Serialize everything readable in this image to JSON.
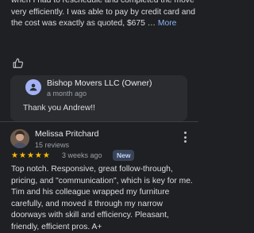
{
  "reviews": [
    {
      "text": "when I had to reschedule and completed the move very efficiently. I was able to pay by credit card and the cost was exactly as quoted, $675 …",
      "more_label": "More",
      "like_icon": "thumbs-up-icon",
      "owner_reply": {
        "name": "Bishop Movers LLC (Owner)",
        "time": "a month ago",
        "text": "Thank you Andrew!!"
      }
    },
    {
      "reviewer": {
        "name": "Melissa Pritchard",
        "meta": "15 reviews"
      },
      "rating": 5,
      "stars": [
        "★",
        "★",
        "★",
        "★",
        "★"
      ],
      "time": "3 weeks ago",
      "badge": "New",
      "text": "Top notch. Responsive, great follow-through, pricing, and \"communication\", which is key for me. Tim and his colleague wrapped my furniture carefully, and moved it through my narrow doorways with skill and efficiency. Pleasant, friendly, efficient pros. A+"
    }
  ],
  "colors": {
    "background": "#1f2023",
    "star": "#fbbc04",
    "link": "#8ab4f8",
    "badge_bg": "#394457"
  },
  "icons": {
    "more": "more-vert-icon",
    "owner_avatar": "owner-avatar-icon"
  }
}
